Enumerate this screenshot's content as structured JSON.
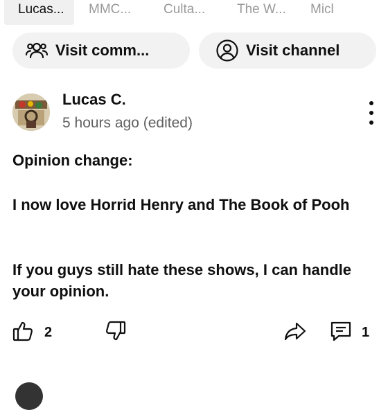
{
  "tabs": [
    {
      "label": "Lucas...",
      "active": true
    },
    {
      "label": "MMC...",
      "active": false
    },
    {
      "label": "Culta...",
      "active": false
    },
    {
      "label": "The W...",
      "active": false
    },
    {
      "label": "Micl",
      "active": false
    }
  ],
  "buttons": {
    "visit_community": "Visit comm...",
    "visit_channel": "Visit channel"
  },
  "post": {
    "author": "Lucas C.",
    "timestamp": "5 hours ago (edited)",
    "paragraph_1": "Opinion change:",
    "paragraph_2": "I now love Horrid Henry and The Book of Pooh",
    "paragraph_3": "If you guys still hate these shows, I can handle your opinion.",
    "like_count": "2",
    "comment_count": "1"
  },
  "icons": {
    "community": "community-icon",
    "channel": "account-circle-icon",
    "more": "more-vertical-icon",
    "like": "thumbs-up-icon",
    "dislike": "thumbs-down-icon",
    "share": "share-icon",
    "comment": "comment-icon"
  },
  "colors": {
    "text": "#0f0f0f",
    "muted": "#606060",
    "pill_bg": "#f2f2f2",
    "tab_inactive": "#9a9a9a"
  }
}
